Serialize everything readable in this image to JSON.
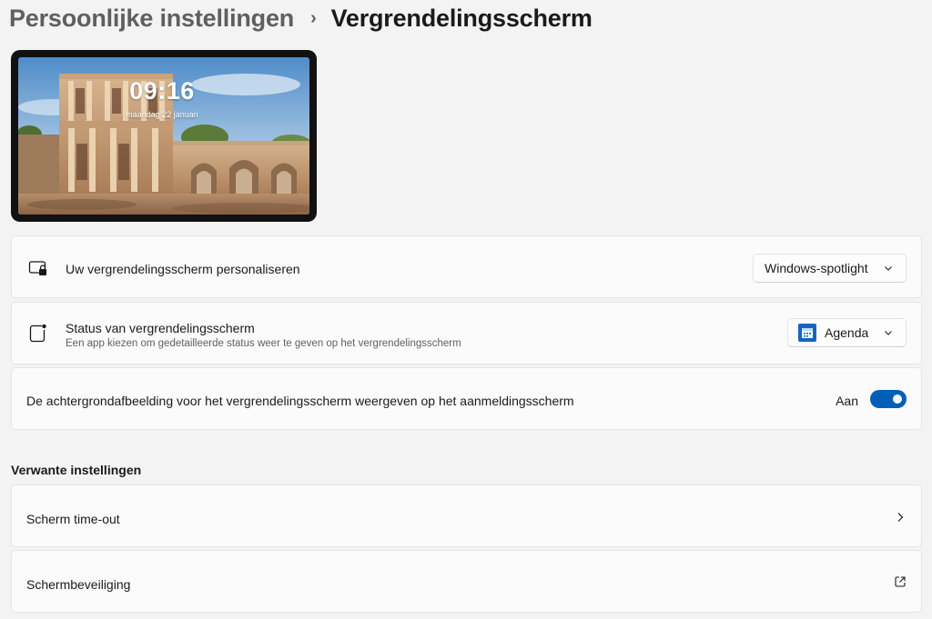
{
  "breadcrumb": {
    "parent": "Persoonlijke instellingen",
    "separator": "›",
    "current": "Vergrendelingsscherm"
  },
  "preview": {
    "time": "09:16",
    "date": "maandag 22 januari"
  },
  "settings": {
    "personalize": {
      "icon": "lock-screen-icon",
      "label": "Uw vergrendelingsscherm personaliseren",
      "selected": "Windows-spotlight"
    },
    "status": {
      "icon": "lock-screen-status-icon",
      "label": "Status van vergrendelingsscherm",
      "description": "Een app kiezen om gedetailleerde status weer te geven op het vergrendelingsscherm",
      "selected": "Agenda",
      "selected_icon": "calendar-app-icon"
    },
    "signin_background": {
      "label": "De achtergrondafbeelding voor het vergrendelingsscherm weergeven op het aanmeldingsscherm",
      "state_label": "Aan",
      "on": true
    }
  },
  "related": {
    "heading": "Verwante instellingen",
    "items": [
      {
        "label": "Scherm time-out",
        "icon": "chevron-right-icon"
      },
      {
        "label": "Schermbeveiliging",
        "icon": "open-external-icon"
      }
    ]
  },
  "colors": {
    "accent": "#005fb8",
    "background": "#f3f3f3",
    "card": "#fbfbfb"
  }
}
